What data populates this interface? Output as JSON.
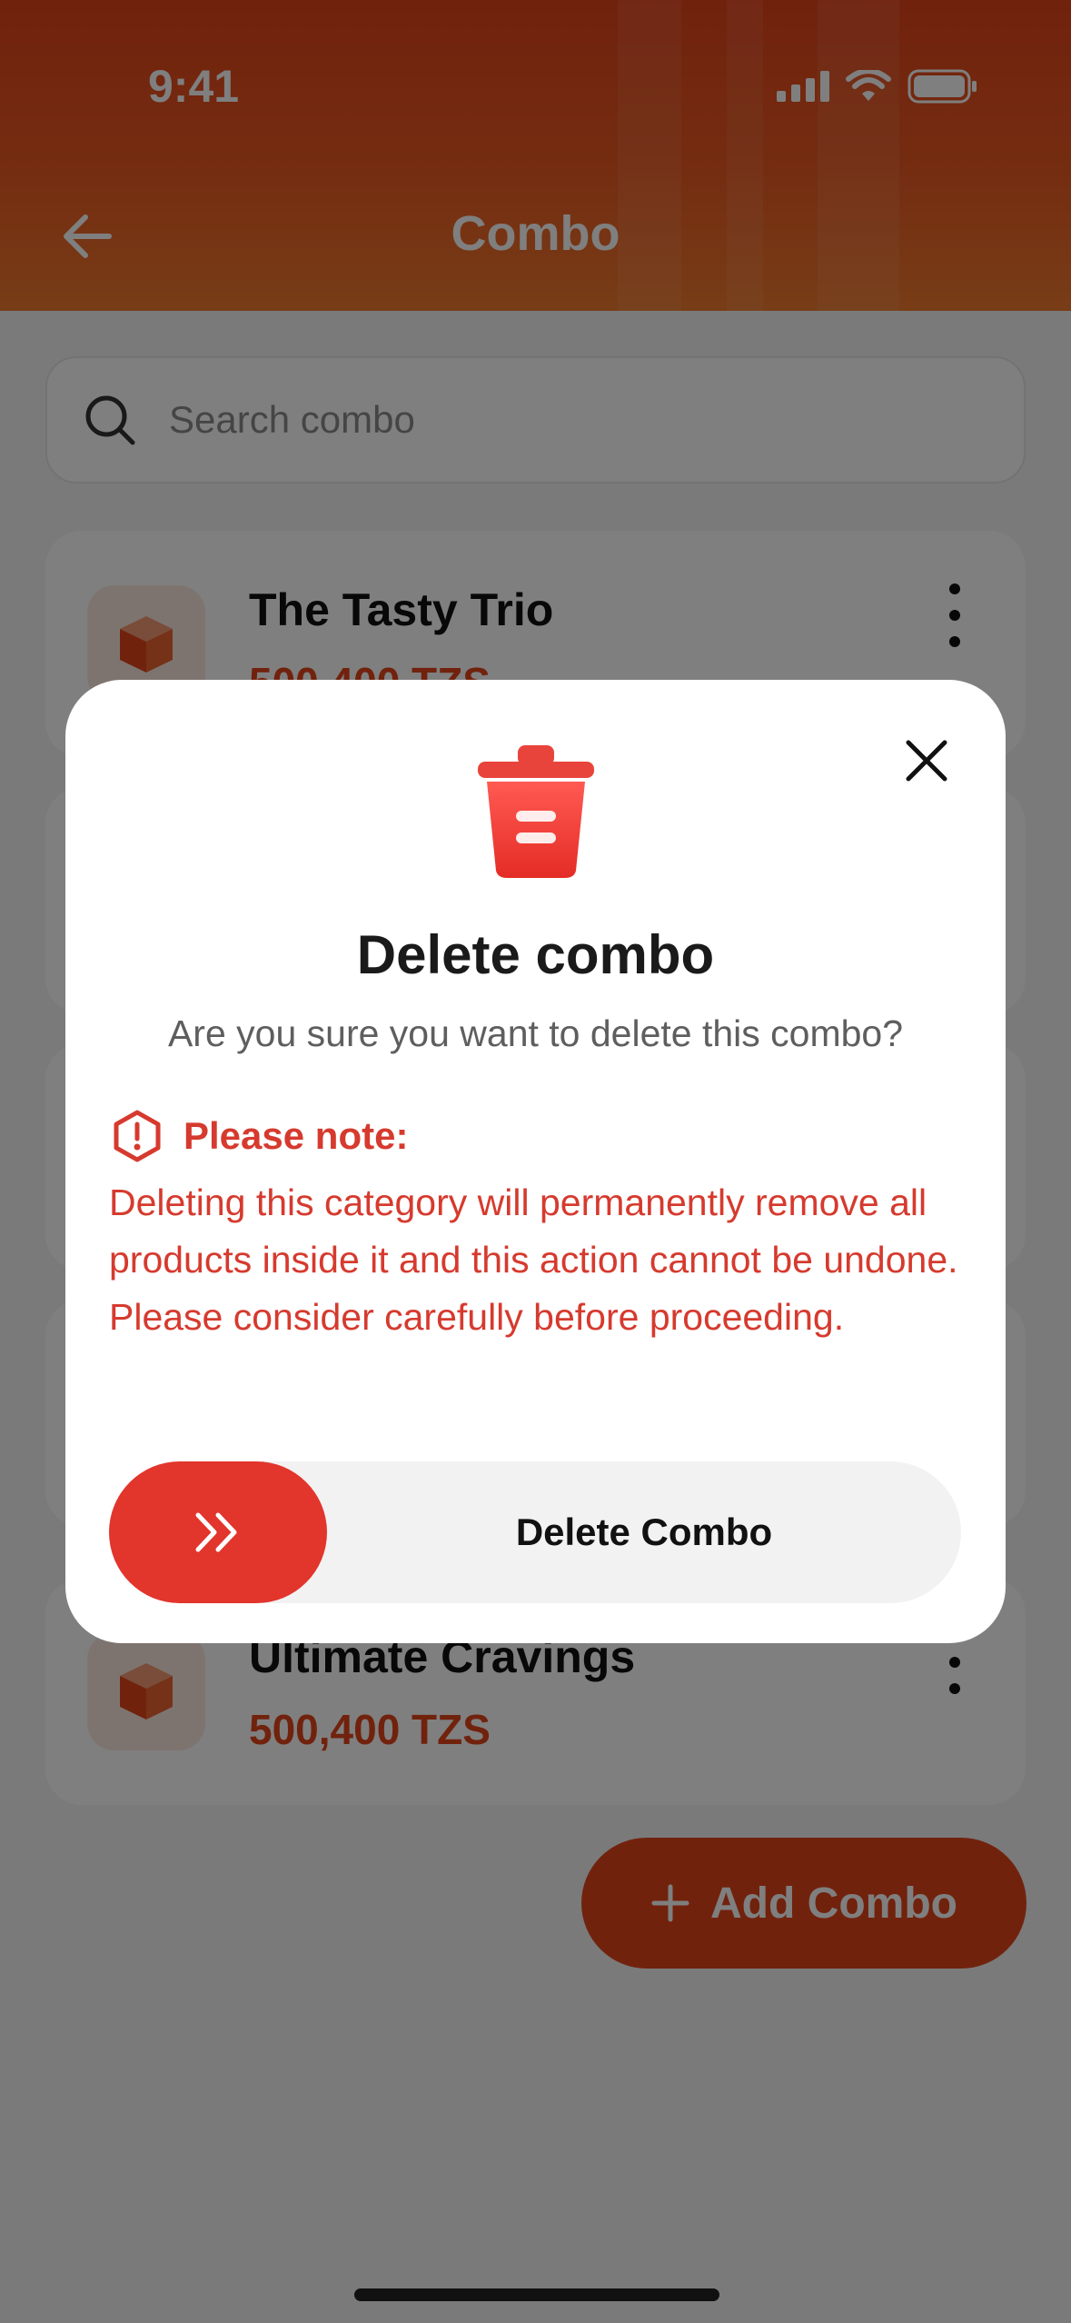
{
  "status_bar": {
    "time": "9:41"
  },
  "header": {
    "title": "Combo"
  },
  "search": {
    "placeholder": "Search combo"
  },
  "combos": [
    {
      "name": "The Tasty Trio",
      "price": "500,400 TZS"
    },
    {
      "name": "Ultimate Cravings",
      "price": "500,400 TZS"
    }
  ],
  "add_button": {
    "label": "Add Combo"
  },
  "modal": {
    "title": "Delete combo",
    "subtitle": "Are you sure you want to delete this combo?",
    "note_title": "Please note:",
    "note_body": "Deleting this category will permanently remove all products inside it and this action cannot be undone. Please consider carefully before proceeding.",
    "slider_label": "Delete Combo"
  },
  "colors": {
    "brand": "#e2441a",
    "danger": "#d63a2e",
    "overlay": "rgba(0,0,0,0.5)"
  },
  "icons": [
    "back-arrow-icon",
    "search-icon",
    "cube-icon",
    "kebab-menu-icon",
    "plus-icon",
    "close-icon",
    "trash-icon",
    "warning-hexagon-icon",
    "double-chevron-right-icon"
  ]
}
